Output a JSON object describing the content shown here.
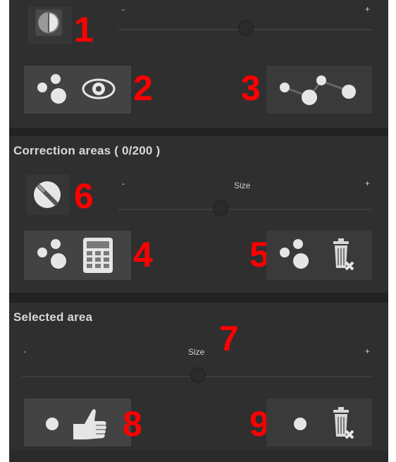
{
  "top_panel": {
    "slider": {
      "min_label": "-",
      "max_label": "+"
    },
    "callouts": {
      "n1": "1",
      "n2": "2",
      "n3": "3"
    }
  },
  "correction_areas": {
    "title": "Correction areas ( 0/200 )",
    "size_slider": {
      "label": "Size",
      "min_label": "-",
      "max_label": "+"
    },
    "callouts": {
      "n6": "6",
      "n4": "4",
      "n5": "5"
    }
  },
  "selected_area": {
    "title": "Selected area",
    "size_slider": {
      "label": "Size",
      "min_label": "-",
      "max_label": "+"
    },
    "callouts": {
      "n7": "7",
      "n8": "8",
      "n9": "9"
    }
  },
  "icons": [
    "compare-icon",
    "show-points-icon",
    "connect-points-icon",
    "brush-tool-icon",
    "calculate-icon",
    "delete-all-icon",
    "approve-icon",
    "delete-selected-icon"
  ],
  "colors": {
    "panel_bg": "#2f2f2f",
    "callout": "#ff0000"
  }
}
